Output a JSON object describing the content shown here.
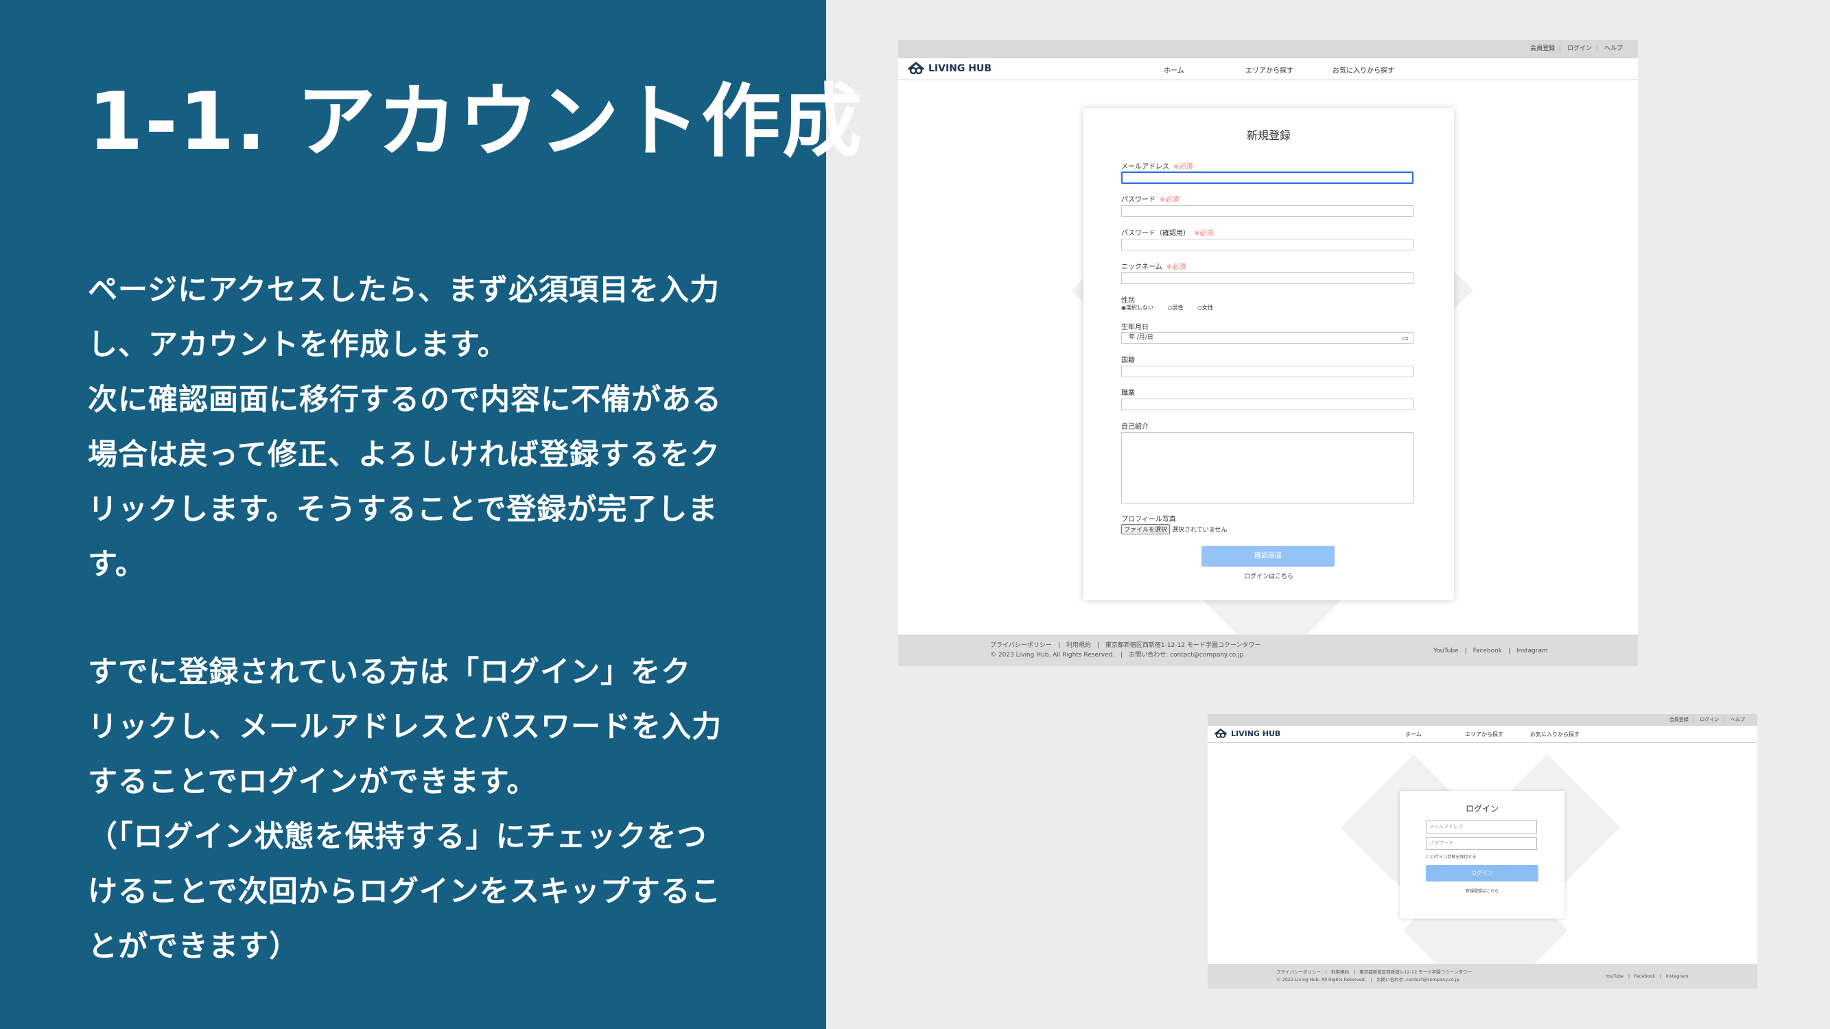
{
  "slide": {
    "title": "1-1. アカウント作成",
    "para1": [
      "ページにアクセスしたら、まず必須項目を入力",
      "し、アカウントを作成します。",
      "次に確認画面に移行するので内容に不備がある",
      "場合は戻って修正、よろしければ登録するをク",
      "リックします。そうすることで登録が完了しま",
      "す。"
    ],
    "para2": [
      "すでに登録されている方は「ログイン」をク",
      "リックし、メールアドレスとパスワードを入力",
      "することでログインができます。",
      "（「ログイン状態を保持する」にチェックをつ",
      "けることで次回からログインをスキップするこ",
      "とができます）"
    ]
  },
  "site": {
    "brand": "LIVING HUB",
    "topbar": [
      "会員登録",
      "ログイン",
      "ヘルプ"
    ],
    "nav": [
      "ホーム",
      "エリアから探す",
      "お気に入りから探す"
    ],
    "footer": {
      "links": "プライバシーポリシー　|　利用規約　|　東京都新宿区西新宿1-12-12 モード学園コクーンタワー",
      "copyright": "© 2023 Living Hub. All Rights Reserved.　|　お問い合わせ: contact@company.co.jp",
      "social": "YouTube　|　Facebook　|　Instagram"
    }
  },
  "register": {
    "title": "新規登録",
    "required": "※必須",
    "email_label": "メールアドレス",
    "password_label": "パスワード",
    "password_confirm_label": "パスワード（確認用）",
    "nickname_label": "ニックネーム",
    "gender_label": "性別",
    "gender_options": [
      "◉選択しない",
      "○男性",
      "○女性"
    ],
    "birthday_label": "生年月日",
    "birthday_placeholder": "年 /月/日",
    "nationality_label": "国籍",
    "occupation_label": "職業",
    "bio_label": "自己紹介",
    "photo_label": "プロフィール写真",
    "file_button": "ファイルを選択",
    "file_status": "選択されていません",
    "confirm_button": "確認画面",
    "login_link": "ログインはこちら"
  },
  "login": {
    "title": "ログイン",
    "email_placeholder": "メールアドレス",
    "password_placeholder": "パスワード",
    "remember": "ログイン状態を保持する",
    "login_button": "ログイン",
    "register_link": "新規登録はこちら"
  },
  "colors": {
    "panel": "#165f83",
    "accent": "#95c3f7",
    "required": "#f07878"
  }
}
